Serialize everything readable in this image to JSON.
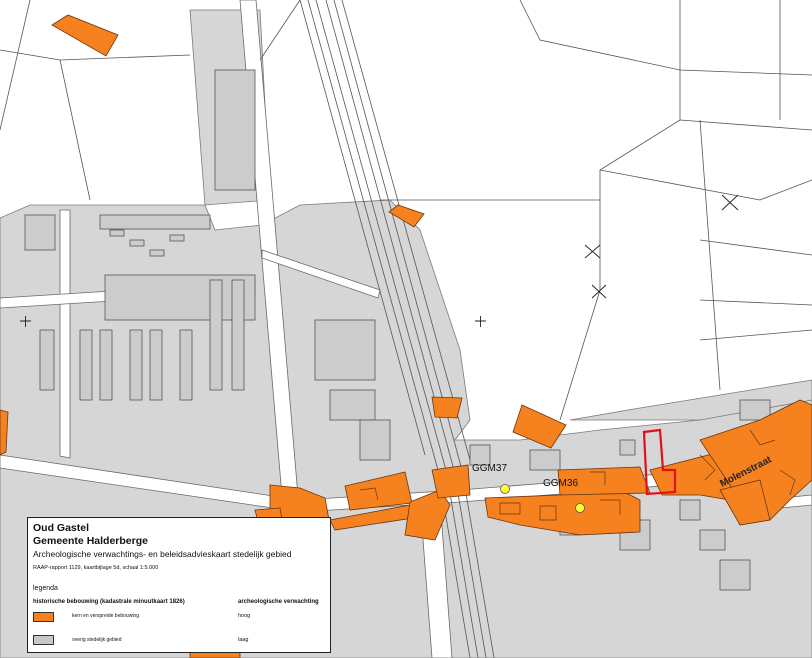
{
  "map": {
    "site_labels": [
      {
        "id": "ggm37",
        "text": "GGM37"
      },
      {
        "id": "ggm36",
        "text": "GGM36"
      }
    ],
    "street_label": "Molenstraat",
    "colors": {
      "historic_building": "#f5821f",
      "urban_area": "#d6d6d6",
      "outline": "#6a6a6a",
      "site_marker": "#ffff33",
      "study_area": "#e3101a"
    }
  },
  "legend": {
    "title_line1": "Oud Gastel",
    "title_line2": "Gemeente Halderberge",
    "subtitle": "Archeologische verwachtings- en beleidsadvieskaart stedelijk gebied",
    "report": "RAAP-rapport 1129, kaartbijlage 5d, schaal 1:5.000",
    "heading": "legenda",
    "col_left": "historische bebouwing (kadastrale minuutkaart 1826)",
    "col_right": "archeologische verwachting",
    "items": [
      {
        "label": "kern en verspreide bebouwing",
        "level": "hoog",
        "color": "#f5821f"
      },
      {
        "label": "overig stedelijk gebied",
        "level": "laag",
        "color": "#c8c8c8"
      }
    ]
  }
}
